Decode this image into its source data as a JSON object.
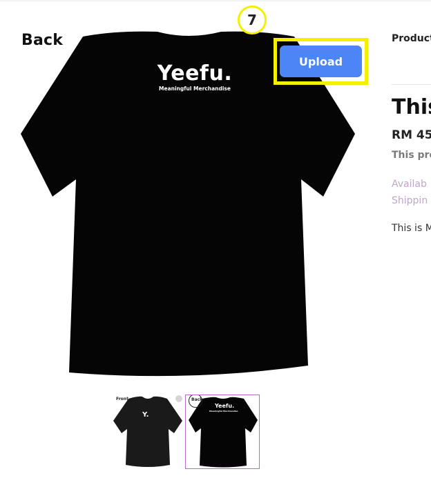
{
  "gallery": {
    "view_label": "Back",
    "brand_name": "Yeefu.",
    "brand_tagline": "Meaningful Merchandise",
    "thumbnails": [
      {
        "label": "Front",
        "print": "Y.",
        "selected": false
      },
      {
        "label": "Back",
        "print": "Yeefu.",
        "selected": true
      }
    ]
  },
  "upload_button": {
    "label": "Upload",
    "color": "#4c86f6"
  },
  "annotation": {
    "step": "7",
    "color": "#f5f000"
  },
  "details": {
    "product_link": "Product",
    "title": "This",
    "price": "RM 45",
    "note": "This pro",
    "availability": "Availab",
    "shipping": "Shippin",
    "description": "This is M"
  },
  "colors": {
    "selected_border": "#b36ac2",
    "shirt": "#050505"
  }
}
